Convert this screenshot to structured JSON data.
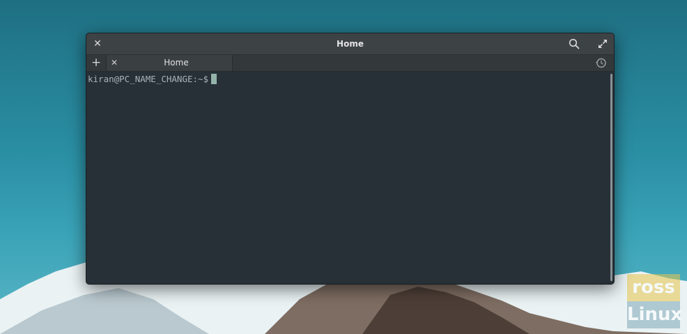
{
  "window": {
    "title": "Home"
  },
  "tabs": [
    {
      "label": "Home"
    }
  ],
  "terminal": {
    "prompt": "kiran@PC_NAME_CHANGE:~$"
  },
  "watermark": {
    "line1": "ross",
    "line2": "Linux"
  },
  "icons": {
    "close": "close-icon",
    "search": "search-icon",
    "maximize": "maximize-icon",
    "new_tab": "plus-icon",
    "tab_close": "close-icon",
    "history": "history-icon"
  },
  "colors": {
    "window_bg": "#263036",
    "titlebar_bg": "#3d4245",
    "prompt_text": "#a8b3b8",
    "cursor": "#93b3a8"
  }
}
